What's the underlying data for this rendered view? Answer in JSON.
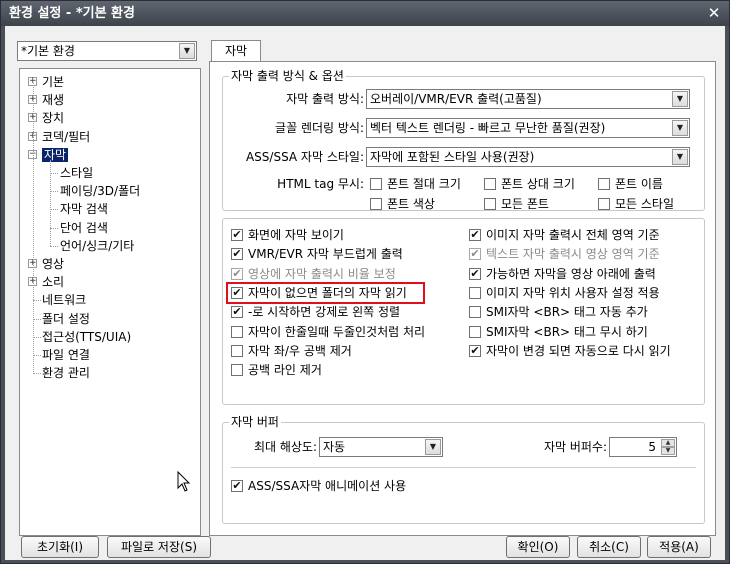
{
  "window": {
    "title": "환경 설정 - *기본 환경",
    "close_glyph": "✕"
  },
  "profile_combo": {
    "value": "*기본 환경"
  },
  "tree": {
    "items": [
      {
        "label": "기본",
        "expandable": true
      },
      {
        "label": "재생",
        "expandable": true
      },
      {
        "label": "장치",
        "expandable": true
      },
      {
        "label": "코덱/필터",
        "expandable": true
      },
      {
        "label": "자막",
        "expandable": true,
        "expanded": true,
        "selected": true
      },
      {
        "label": "스타일"
      },
      {
        "label": "페이딩/3D/폴더"
      },
      {
        "label": "자막 검색"
      },
      {
        "label": "단어 검색"
      },
      {
        "label": "언어/싱크/기타"
      },
      {
        "label": "영상",
        "expandable": true
      },
      {
        "label": "소리",
        "expandable": true
      },
      {
        "label": "네트워크"
      },
      {
        "label": "폴더 설정"
      },
      {
        "label": "접근성(TTS/UIA)"
      },
      {
        "label": "파일 연결"
      },
      {
        "label": "환경 관리"
      }
    ]
  },
  "tab": {
    "label": "자막"
  },
  "output_group": {
    "title": "자막 출력 방식 & 옵션",
    "output_mode_label": "자막 출력 방식:",
    "output_mode_value": "오버레이/VMR/EVR 출력(고품질)",
    "font_render_label": "글꼴 렌더링 방식:",
    "font_render_value": "벡터 텍스트 렌더링 - 빠르고 무난한 품질(권장)",
    "ass_style_label": "ASS/SSA 자막 스타일:",
    "ass_style_value": "자막에 포함된 스타일 사용(권장)",
    "html_label": "HTML tag 무시:",
    "html_options": [
      {
        "label": "폰트 절대 크기",
        "checked": false
      },
      {
        "label": "폰트 상대 크기",
        "checked": false
      },
      {
        "label": "폰트 이름",
        "checked": false
      },
      {
        "label": "폰트 색상",
        "checked": false
      },
      {
        "label": "모든 폰트",
        "checked": false
      },
      {
        "label": "모든 스타일",
        "checked": false
      }
    ]
  },
  "options_left": [
    {
      "label": "화면에 자막 보이기",
      "checked": true
    },
    {
      "label": "VMR/EVR 자막 부드럽게 출력",
      "checked": true
    },
    {
      "label": "영상에 자막 출력시 비율 보정",
      "checked": true,
      "disabled": true
    },
    {
      "label": "자막이 없으면 폴더의 자막 읽기",
      "checked": true,
      "highlighted": true
    },
    {
      "label": "-로 시작하면 강제로 왼쪽 정렬",
      "checked": true
    },
    {
      "label": "자막이 한줄일때 두줄인것처럼 처리",
      "checked": false
    },
    {
      "label": "자막 좌/우 공백 제거",
      "checked": false
    },
    {
      "label": "공백 라인 제거",
      "checked": false
    }
  ],
  "options_right": [
    {
      "label": "이미지 자막 출력시 전체 영역 기준",
      "checked": true
    },
    {
      "label": "텍스트 자막 출력시 영상 영역 기준",
      "checked": true,
      "disabled": true
    },
    {
      "label": "가능하면 자막을 영상 아래에 출력",
      "checked": true
    },
    {
      "label": "이미지 자막 위치 사용자 설정 적용",
      "checked": false
    },
    {
      "label": "SMI자막 <BR> 태그 자동 추가",
      "checked": false
    },
    {
      "label": "SMI자막 <BR> 태그 무시 하기",
      "checked": false
    },
    {
      "label": "자막이 변경 되면 자동으로 다시 읽기",
      "checked": true
    }
  ],
  "buffer_group": {
    "title": "자막 버퍼",
    "max_res_label": "최대 해상도:",
    "max_res_value": "자동",
    "buffer_count_label": "자막 버퍼수:",
    "buffer_count_value": "5"
  },
  "ass_animation": {
    "label": "ASS/SSA자막 애니메이션 사용",
    "checked": true
  },
  "buttons": {
    "reset": "초기화(I)",
    "save_file": "파일로 저장(S)",
    "ok": "확인(O)",
    "cancel": "취소(C)",
    "apply": "적용(A)"
  },
  "icons": {
    "check": "✔",
    "combo_arrow": "▼",
    "spin_up": "▲",
    "spin_down": "▼",
    "plus": "+",
    "minus": "−"
  }
}
